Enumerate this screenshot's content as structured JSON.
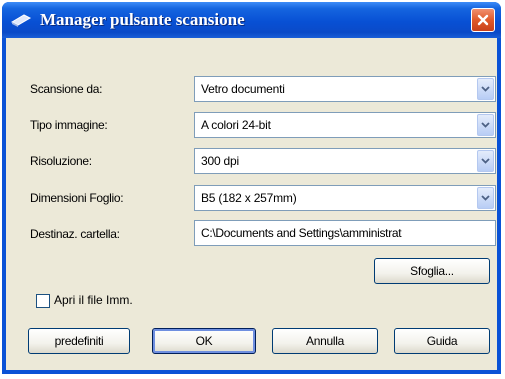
{
  "window": {
    "title": "Manager pulsante scansione"
  },
  "form": {
    "scan_from": {
      "label": "Scansione da:",
      "value": "Vetro documenti"
    },
    "image_type": {
      "label": "Tipo immagine:",
      "value": "A colori 24-bit"
    },
    "resolution": {
      "label": "Risoluzione:",
      "value": "300 dpi"
    },
    "page_size": {
      "label": "Dimensioni Foglio:",
      "value": "B5 (182 x 257mm)"
    },
    "destination": {
      "label": "Destinaz. cartella:",
      "value": "C:\\Documents and Settings\\amministrat"
    }
  },
  "browse_button": "Sfoglia...",
  "open_file": {
    "label": "Apri il file Imm.",
    "checked": false
  },
  "buttons": {
    "defaults": "predefiniti",
    "ok": "OK",
    "cancel": "Annulla",
    "help": "Guida"
  }
}
